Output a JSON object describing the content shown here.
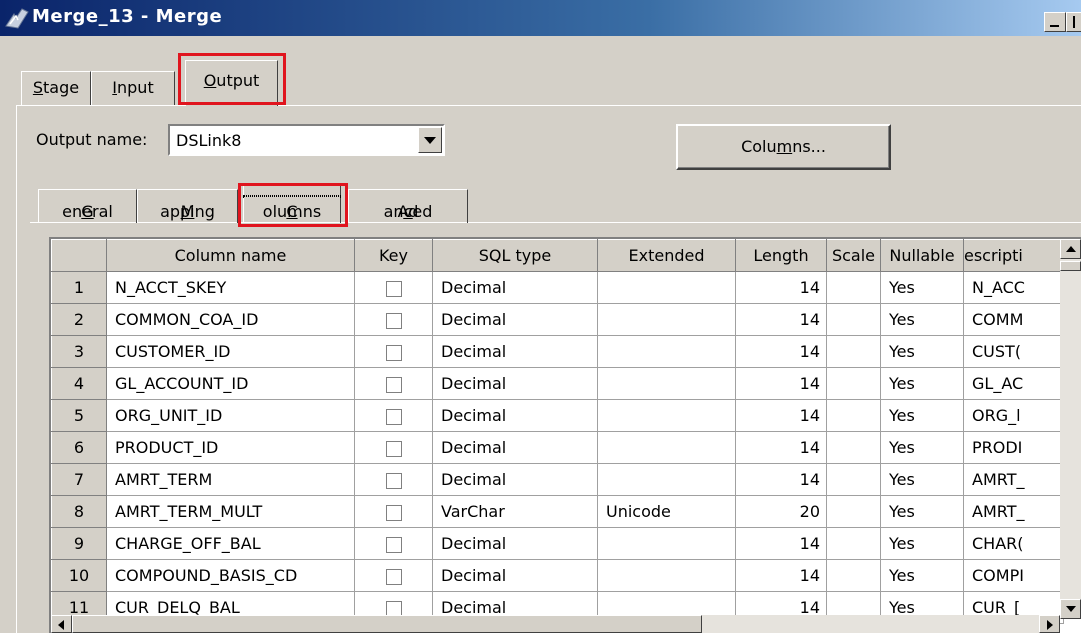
{
  "window": {
    "title": "Merge_13 - Merge"
  },
  "tabs": [
    {
      "label": "Stage",
      "accel": "S",
      "rest": "tage"
    },
    {
      "label": "Input",
      "accel": "I",
      "rest": "nput"
    },
    {
      "label": "Output",
      "accel": "O",
      "rest": "utput",
      "active": true
    }
  ],
  "output_name": {
    "label": "Output name:",
    "value": "DSLink8"
  },
  "columns_button": {
    "pre": "Colu",
    "accel": "m",
    "post": "ns..."
  },
  "subtabs": [
    {
      "label": "General",
      "accel": "G",
      "rest": "eneral"
    },
    {
      "label": "Mapping",
      "accel": "M",
      "rest": "apping"
    },
    {
      "label": "Columns",
      "accel": "C",
      "rest": "olumns",
      "active": true
    },
    {
      "label": "Advanced",
      "pre": "Ad",
      "accel": "v",
      "post": "anced"
    }
  ],
  "grid": {
    "headers": [
      "Column name",
      "Key",
      "SQL type",
      "Extended",
      "Length",
      "Scale",
      "Nullable",
      "escripti"
    ],
    "rows": [
      {
        "n": "1",
        "name": "N_ACCT_SKEY",
        "key": false,
        "sql": "Decimal",
        "ext": "",
        "len": "14",
        "scale": "",
        "null": "Yes",
        "desc": "N_ACC"
      },
      {
        "n": "2",
        "name": "COMMON_COA_ID",
        "key": false,
        "sql": "Decimal",
        "ext": "",
        "len": "14",
        "scale": "",
        "null": "Yes",
        "desc": "COMM"
      },
      {
        "n": "3",
        "name": "CUSTOMER_ID",
        "key": false,
        "sql": "Decimal",
        "ext": "",
        "len": "14",
        "scale": "",
        "null": "Yes",
        "desc": "CUST("
      },
      {
        "n": "4",
        "name": "GL_ACCOUNT_ID",
        "key": false,
        "sql": "Decimal",
        "ext": "",
        "len": "14",
        "scale": "",
        "null": "Yes",
        "desc": "GL_AC"
      },
      {
        "n": "5",
        "name": "ORG_UNIT_ID",
        "key": false,
        "sql": "Decimal",
        "ext": "",
        "len": "14",
        "scale": "",
        "null": "Yes",
        "desc": "ORG_l"
      },
      {
        "n": "6",
        "name": "PRODUCT_ID",
        "key": false,
        "sql": "Decimal",
        "ext": "",
        "len": "14",
        "scale": "",
        "null": "Yes",
        "desc": "PRODI"
      },
      {
        "n": "7",
        "name": "AMRT_TERM",
        "key": false,
        "sql": "Decimal",
        "ext": "",
        "len": "14",
        "scale": "",
        "null": "Yes",
        "desc": "AMRT_"
      },
      {
        "n": "8",
        "name": "AMRT_TERM_MULT",
        "key": false,
        "sql": "VarChar",
        "ext": "Unicode",
        "len": "20",
        "scale": "",
        "null": "Yes",
        "desc": "AMRT_"
      },
      {
        "n": "9",
        "name": "CHARGE_OFF_BAL",
        "key": false,
        "sql": "Decimal",
        "ext": "",
        "len": "14",
        "scale": "",
        "null": "Yes",
        "desc": "CHAR("
      },
      {
        "n": "10",
        "name": "COMPOUND_BASIS_CD",
        "key": false,
        "sql": "Decimal",
        "ext": "",
        "len": "14",
        "scale": "",
        "null": "Yes",
        "desc": "COMPI"
      },
      {
        "n": "11",
        "name": "CUR_DELQ_BAL",
        "key": false,
        "sql": "Decimal",
        "ext": "",
        "len": "14",
        "scale": "",
        "null": "Yes",
        "desc": "CUR_["
      }
    ]
  }
}
